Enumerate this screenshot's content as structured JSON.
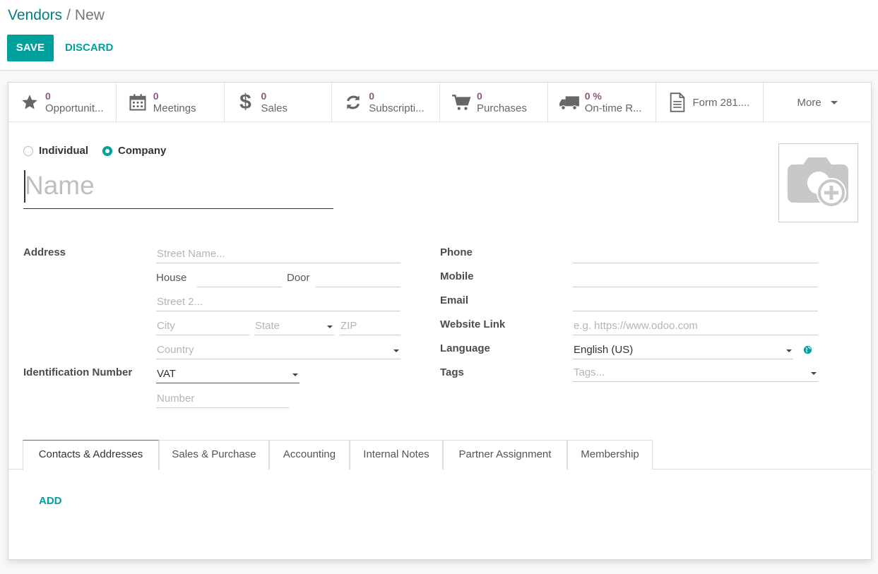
{
  "breadcrumb": {
    "parent": "Vendors",
    "separator": "/",
    "current": "New"
  },
  "actions": {
    "save_label": "SAVE",
    "discard_label": "DISCARD"
  },
  "stat_buttons": [
    {
      "icon": "star-icon",
      "value": "0",
      "label": "Opportunit..."
    },
    {
      "icon": "calendar-icon",
      "value": "0",
      "label": "Meetings"
    },
    {
      "icon": "dollar-icon",
      "value": "0",
      "label": "Sales"
    },
    {
      "icon": "refresh-icon",
      "value": "0",
      "label": "Subscripti..."
    },
    {
      "icon": "cart-icon",
      "value": "0",
      "label": "Purchases"
    },
    {
      "icon": "truck-icon",
      "value": "0 %",
      "label": "On-time R..."
    },
    {
      "icon": "document-icon",
      "label": "Form 281...."
    }
  ],
  "more_label": "More",
  "company_type": {
    "individual": "Individual",
    "company": "Company",
    "selected": "Company"
  },
  "name_placeholder": "Name",
  "address": {
    "label": "Address",
    "street_placeholder": "Street Name...",
    "house_label": "House",
    "door_label": "Door",
    "street2_placeholder": "Street 2...",
    "city_placeholder": "City",
    "state_placeholder": "State",
    "zip_placeholder": "ZIP",
    "country_placeholder": "Country"
  },
  "identification": {
    "label": "Identification Number",
    "type_value": "VAT",
    "number_placeholder": "Number"
  },
  "contact": {
    "phone_label": "Phone",
    "mobile_label": "Mobile",
    "email_label": "Email",
    "website_label": "Website Link",
    "website_placeholder": "e.g. https://www.odoo.com",
    "language_label": "Language",
    "language_value": "English (US)",
    "tags_label": "Tags",
    "tags_placeholder": "Tags..."
  },
  "tabs": [
    {
      "label": "Contacts & Addresses",
      "active": true
    },
    {
      "label": "Sales & Purchase"
    },
    {
      "label": "Accounting"
    },
    {
      "label": "Internal Notes"
    },
    {
      "label": "Partner Assignment"
    },
    {
      "label": "Membership"
    }
  ],
  "add_label": "ADD",
  "colors": {
    "accent": "#00a09d",
    "brand_purple": "#875a7b",
    "link": "#017e84"
  }
}
